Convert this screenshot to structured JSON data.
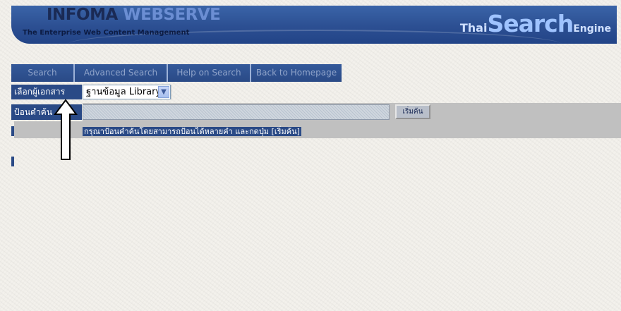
{
  "banner": {
    "brand_part1": "INFOMA ",
    "brand_part2": "WEBSERVE",
    "tagline": "The Enterprise Web Content Management",
    "engine_thai": "Thai",
    "engine_search": "Search",
    "engine_word": "Engine"
  },
  "tabs": [
    {
      "label": "Search"
    },
    {
      "label": "Advanced Search"
    },
    {
      "label": "Help on Search"
    },
    {
      "label": "Back to Homepage"
    }
  ],
  "form": {
    "select_label": "เลือกผู้เอกสาร",
    "select_value": "ฐานข้อมูล Library",
    "query_label": "ป้อนคำค้น",
    "query_value": "",
    "start_label": "เริ่มค้น",
    "hint": "กรุณาป้อนคำค้นโดยสามารถป้อนได้หลายคำ และกดปุ่ม [เริ่มค้น]"
  },
  "colors": {
    "nav_blue": "#2a4a86",
    "banner_blue": "#2c4f92",
    "band_gray": "#c0c0c0"
  },
  "icons": {
    "dropdown": "chevron-down-icon",
    "annotation": "up-arrow-icon"
  }
}
